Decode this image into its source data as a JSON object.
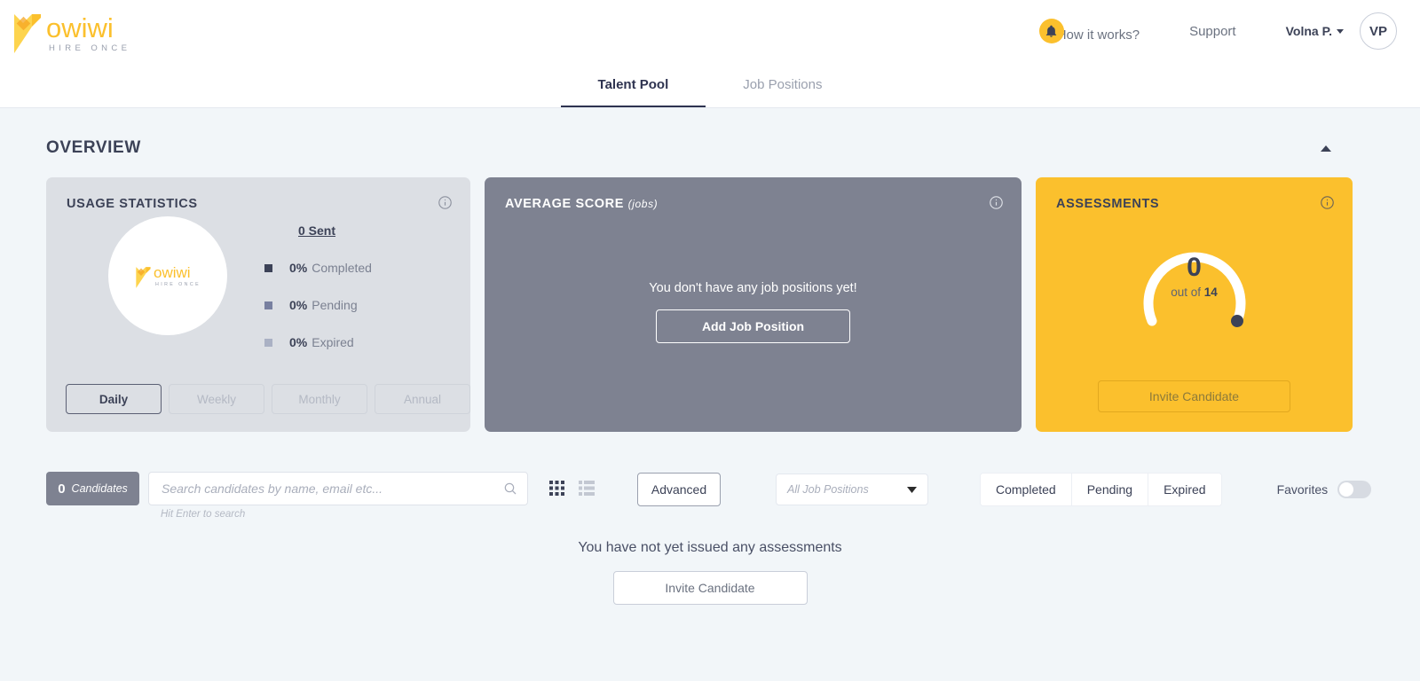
{
  "brand": {
    "word": "owiwi",
    "tagline": "HIRE ONCE",
    "yellow": "#FBC02D",
    "navy": "#3C4257"
  },
  "header": {
    "how_it_works": "How it works?",
    "support": "Support",
    "user_name": "Volna P.",
    "avatar_initials": "VP"
  },
  "tabs": [
    {
      "label": "Talent Pool",
      "active": true
    },
    {
      "label": "Job Positions",
      "active": false
    }
  ],
  "overview": {
    "title": "OVERVIEW"
  },
  "usage_card": {
    "title": "USAGE STATISTICS",
    "sent_label": "0 Sent",
    "legend": [
      {
        "pct": "0%",
        "label": "Completed",
        "color": "#3C4257"
      },
      {
        "pct": "0%",
        "label": "Pending",
        "color": "#7880A0"
      },
      {
        "pct": "0%",
        "label": "Expired",
        "color": "#AAB1C4"
      }
    ],
    "periods": [
      {
        "label": "Daily",
        "active": true
      },
      {
        "label": "Weekly",
        "active": false
      },
      {
        "label": "Monthly",
        "active": false
      },
      {
        "label": "Annual",
        "active": false
      }
    ]
  },
  "average_card": {
    "title": "AVERAGE SCORE",
    "title_sub": "(jobs)",
    "empty_text": "You don't have any job positions yet!",
    "button": "Add Job Position"
  },
  "assessments_card": {
    "title": "ASSESSMENTS",
    "value": "0",
    "out_of_prefix": "out of ",
    "out_of_value": "14",
    "button": "Invite Candidate"
  },
  "filters": {
    "count_number": "0",
    "count_label": "Candidates",
    "search_placeholder": "Search candidates by name, email etc...",
    "search_value": "",
    "search_hint": "Hit Enter to search",
    "advanced_label": "Advanced",
    "job_select_value": "All Job Positions",
    "status_buttons": [
      "Completed",
      "Pending",
      "Expired"
    ],
    "favorites_label": "Favorites",
    "favorites_on": false
  },
  "empty_state": {
    "text": "You have not yet issued any assessments",
    "button": "Invite Candidate"
  },
  "chart_data": {
    "type": "pie",
    "title": "USAGE STATISTICS",
    "categories": [
      "Completed",
      "Pending",
      "Expired"
    ],
    "values": [
      0,
      0,
      0
    ],
    "unit": "%",
    "total_sent": 0,
    "period": "Daily",
    "legend": "right",
    "gauge": {
      "type": "gauge",
      "value": 0,
      "max": 14,
      "title": "ASSESSMENTS"
    }
  }
}
